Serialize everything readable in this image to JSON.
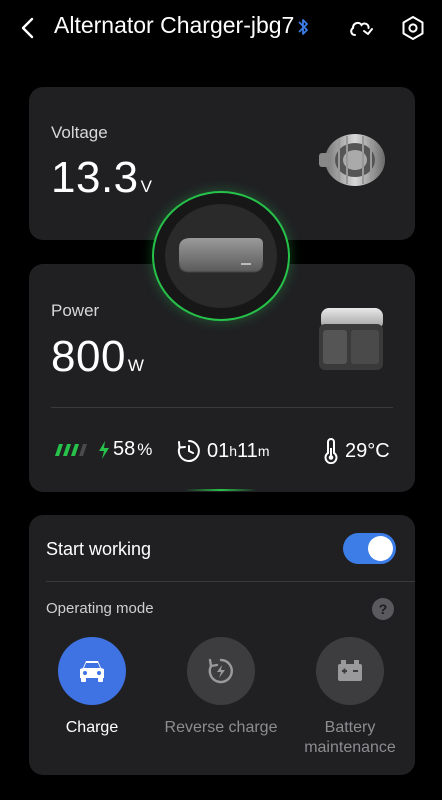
{
  "header": {
    "title": "Alternator Charger-jbg7",
    "icons": [
      "back-icon",
      "bluetooth-icon",
      "cloud-sync-icon",
      "settings-icon"
    ]
  },
  "voltage": {
    "label": "Voltage",
    "value": "13.3",
    "unit": "V"
  },
  "power": {
    "label": "Power",
    "value": "800",
    "unit": "W"
  },
  "stats": {
    "battery_percent": "58",
    "battery_unit": "%",
    "time_h": "01",
    "time_h_unit": "h",
    "time_m": "11",
    "time_m_unit": "m",
    "temperature": "29°C"
  },
  "controls": {
    "start_label": "Start working",
    "start_on": true,
    "operating_mode_label": "Operating mode",
    "help_glyph": "?"
  },
  "modes": [
    {
      "label": "Charge",
      "active": true,
      "icon": "car-icon"
    },
    {
      "label": "Reverse charge",
      "active": false,
      "icon": "reverse-charge-icon"
    },
    {
      "label": "Battery maintenance",
      "active": false,
      "icon": "battery-icon"
    }
  ],
  "colors": {
    "accent": "#3f72e2",
    "status_green": "#26c24a",
    "card_bg": "#202023"
  }
}
